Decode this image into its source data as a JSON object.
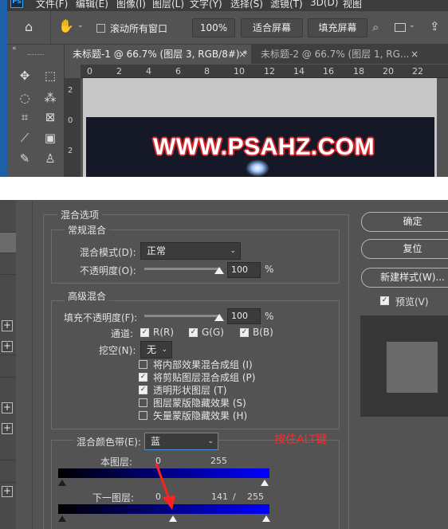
{
  "menu": [
    "文件(F)",
    "编辑(E)",
    "图像(I)",
    "图层(L)",
    "文字(Y)",
    "选择(S)",
    "滤镜(T)",
    "3D(D)",
    "视图"
  ],
  "app_logo": "Ps",
  "options_bar": {
    "scroll_all_label": "滚动所有窗口",
    "zoom_value": "100%",
    "fit_screen": "适合屏幕",
    "fill_screen": "填充屏幕"
  },
  "tabs": [
    {
      "label": "未标题-1 @ 66.7% (图层 3, RGB/8#) *",
      "active": true
    },
    {
      "label": "未标题-2 @ 66.7% (图层 1, RG...",
      "active": false
    }
  ],
  "ruler_ticks": [
    "0",
    "2",
    "4",
    "6",
    "8",
    "10",
    "12",
    "14",
    "16",
    "18",
    "20",
    "22"
  ],
  "ruler_v_ticks": [
    "2",
    "0",
    "2"
  ],
  "canvas_text": "WWW.PSAHZ.COM",
  "dialog": {
    "section_title": "混合选项",
    "general": {
      "legend": "常规混合",
      "blend_mode_label": "混合模式(D):",
      "blend_mode_value": "正常",
      "opacity_label": "不透明度(O):",
      "opacity_value": "100",
      "percent": "%"
    },
    "advanced": {
      "legend": "高级混合",
      "fill_opacity_label": "填充不透明度(F):",
      "fill_opacity_value": "100",
      "percent": "%",
      "channels_label": "通道:",
      "channels": [
        "R(R)",
        "G(G)",
        "B(B)"
      ],
      "knockout_label": "挖空(N):",
      "knockout_value": "无",
      "options": [
        {
          "label": "将内部效果混合成组 (I)",
          "checked": false
        },
        {
          "label": "将剪贴图层混合成组 (P)",
          "checked": true
        },
        {
          "label": "透明形状图层 (T)",
          "checked": true
        },
        {
          "label": "图层蒙版隐藏效果 (S)",
          "checked": false
        },
        {
          "label": "矢量蒙版隐藏效果 (H)",
          "checked": false
        }
      ]
    },
    "blend_if": {
      "label": "混合颜色带(E):",
      "value": "蓝",
      "this_layer_label": "本图层:",
      "this_layer_low": "0",
      "this_layer_high": "255",
      "underlying_label": "下一图层:",
      "underlying_low": "0",
      "underlying_split": "141",
      "slash": "/",
      "underlying_high": "255"
    },
    "buttons": {
      "ok": "确定",
      "reset": "复位",
      "new_style": "新建样式(W)...",
      "preview_label": "预览(V)",
      "preview_checked": true
    },
    "annotation": "按住ALT键"
  }
}
